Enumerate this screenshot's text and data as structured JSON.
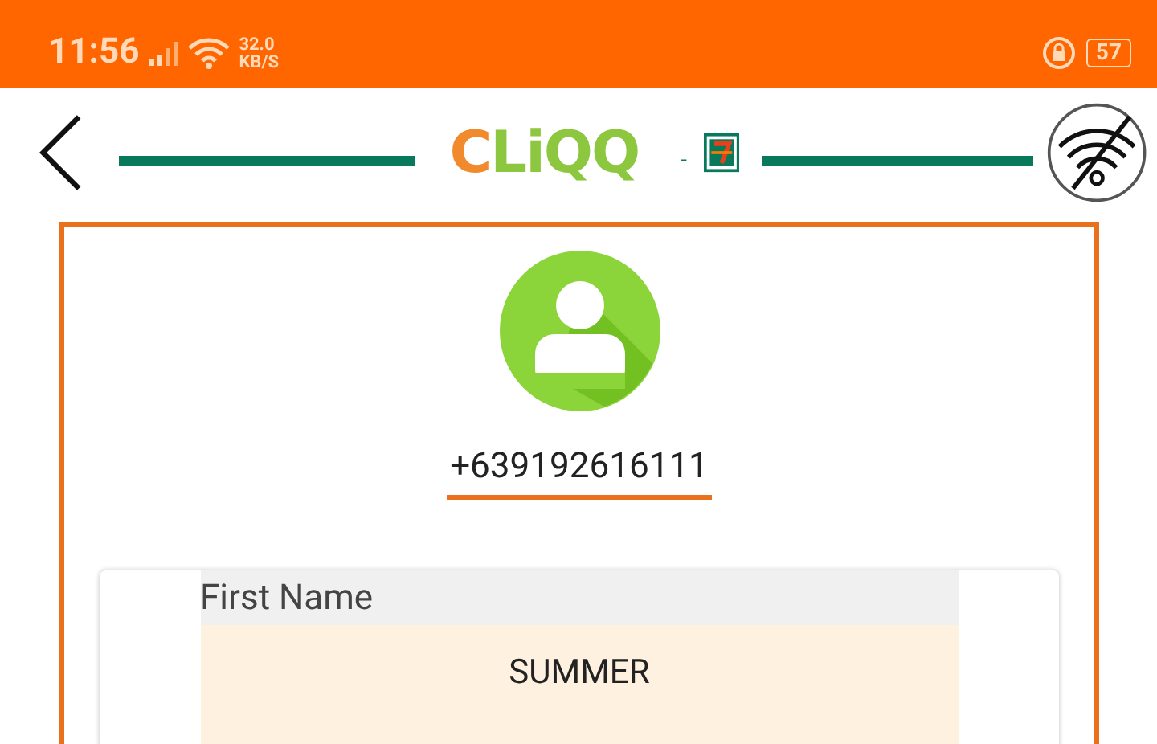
{
  "status_bar": {
    "time": "11:56",
    "speed_value": "32.0",
    "speed_unit": "KB/S",
    "battery": "57"
  },
  "header": {
    "logo": "CLiQQ",
    "separator": "-"
  },
  "profile": {
    "phone": "+639192616111"
  },
  "form": {
    "fields": [
      {
        "label": "First Name",
        "value": "SUMMER"
      }
    ]
  }
}
